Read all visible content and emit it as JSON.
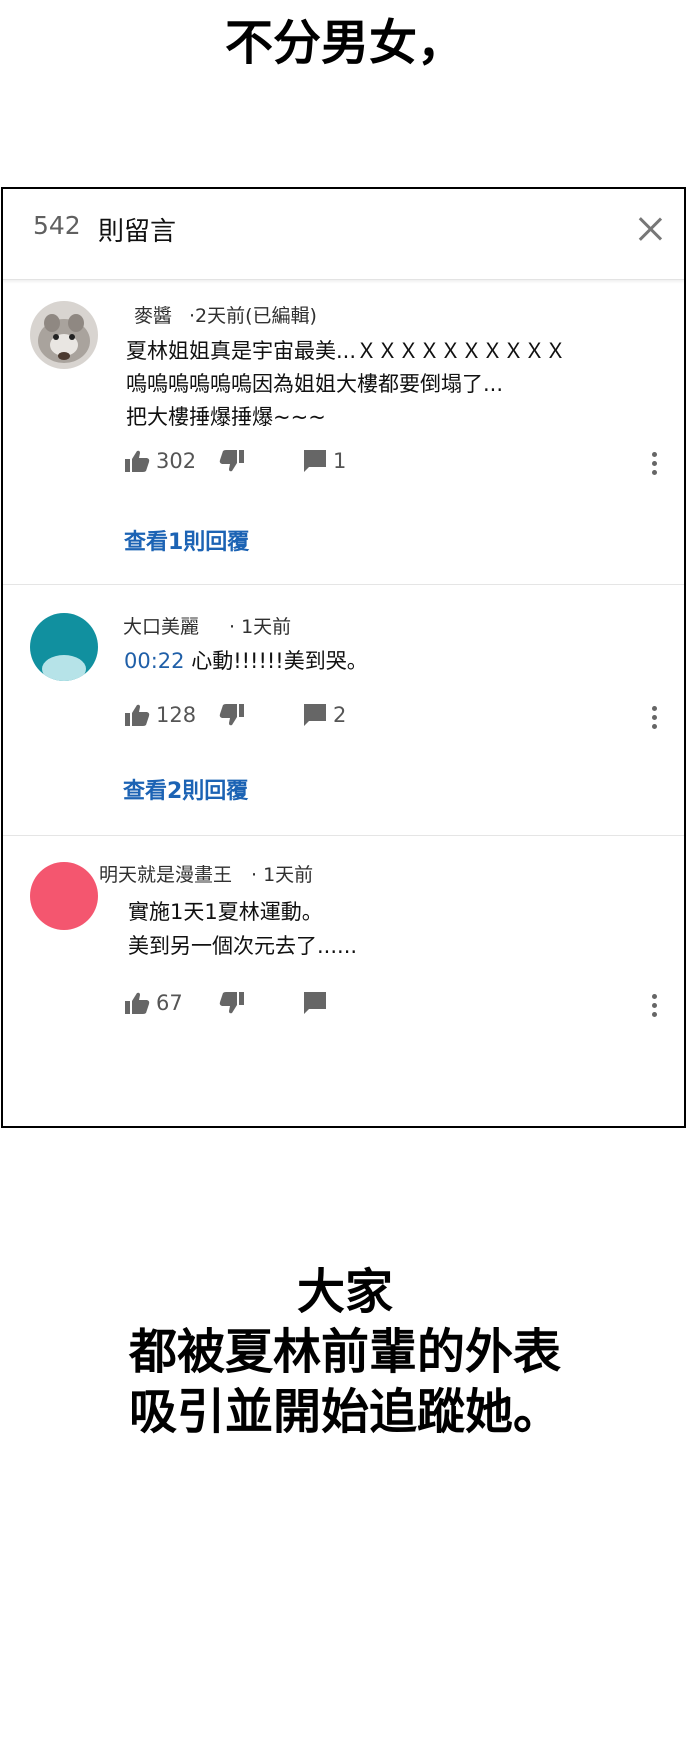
{
  "top_caption": "不分男女，",
  "panel": {
    "comment_count": "542",
    "comment_title": "則留言"
  },
  "comments": [
    {
      "author": "麥醬",
      "meta": "·2天前(已編輯)",
      "lines": [
        "夏林姐姐真是宇宙最美...ＸＸＸＸＸＸＸＸＸＸ",
        "嗚嗚嗚嗚嗚嗚因為姐姐大樓都要倒塌了...",
        "把大樓捶爆捶爆~~~"
      ],
      "likes": "302",
      "replies_count": "1",
      "view_replies": "查看1則回覆",
      "avatar_color": "#b9b4b0"
    },
    {
      "author": "大口美麗",
      "meta": "· 1天前",
      "timestamp_link": "00:22",
      "lines": [
        "心動!!!!!!美到哭。"
      ],
      "likes": "128",
      "replies_count": "2",
      "view_replies": "查看2則回覆",
      "avatar_color": "#11909f"
    },
    {
      "author": "明天就是漫畫王",
      "meta": "· 1天前",
      "lines": [
        "實施1天1夏林運動。",
        "美到另一個次元去了......"
      ],
      "likes": "67",
      "replies_count": "",
      "avatar_color": "#f4566f"
    }
  ],
  "bottom_caption": {
    "line1": "大家",
    "line2": "都被夏林前輩的外表",
    "line3": "吸引並開始追蹤她。"
  },
  "icons": {
    "like": "thumbs-up-icon",
    "dislike": "thumbs-down-icon",
    "reply": "comment-icon",
    "more": "more-vert-icon",
    "close": "close-icon"
  }
}
